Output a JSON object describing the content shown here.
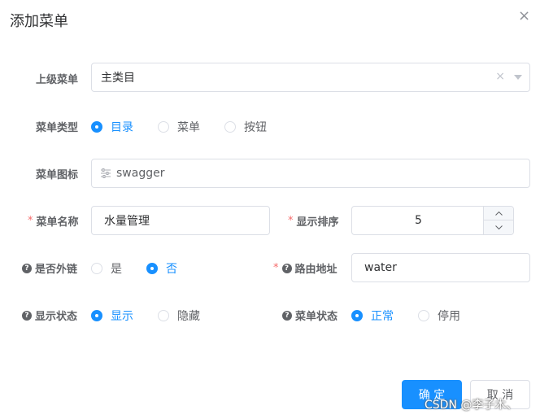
{
  "dialog": {
    "title": "添加菜单",
    "close": "×"
  },
  "form": {
    "parent_menu": {
      "label": "上级菜单",
      "value": "主类目"
    },
    "menu_type": {
      "label": "菜单类型",
      "options": [
        "目录",
        "菜单",
        "按钮"
      ],
      "selected": "目录"
    },
    "menu_icon": {
      "label": "菜单图标",
      "value": "swagger"
    },
    "menu_name": {
      "label": "菜单名称",
      "value": "水量管理"
    },
    "order": {
      "label": "显示排序",
      "value": "5"
    },
    "is_frame": {
      "label": "是否外链",
      "options": [
        "是",
        "否"
      ],
      "selected": "否"
    },
    "route": {
      "label": "路由地址",
      "value": "water"
    },
    "visible": {
      "label": "显示状态",
      "options": [
        "显示",
        "隐藏"
      ],
      "selected": "显示"
    },
    "status": {
      "label": "菜单状态",
      "options": [
        "正常",
        "停用"
      ],
      "selected": "正常"
    }
  },
  "buttons": {
    "confirm": "确 定",
    "cancel": "取 消"
  },
  "watermark": "CSDN @李子木、"
}
